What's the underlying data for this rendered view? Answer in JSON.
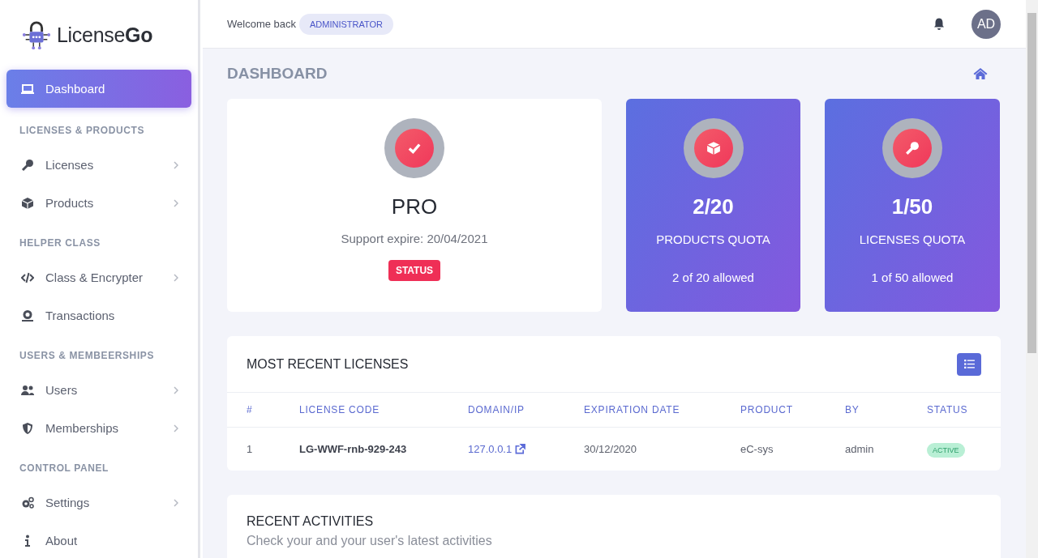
{
  "brand": {
    "name": "License**Go**"
  },
  "sidebar": {
    "items": [
      {
        "kind": "item",
        "label": "Dashboard",
        "selected": true,
        "submenu": false
      },
      {
        "kind": "heading",
        "label": "LICENSES & PRODUCTS"
      },
      {
        "kind": "item",
        "label": "Licenses",
        "selected": false,
        "submenu": true
      },
      {
        "kind": "item",
        "label": "Products",
        "selected": false,
        "submenu": true
      },
      {
        "kind": "heading",
        "label": "HELPER CLASS"
      },
      {
        "kind": "item",
        "label": "Class & Encrypter",
        "selected": false,
        "submenu": true
      },
      {
        "kind": "item",
        "label": "Transactions",
        "selected": false,
        "submenu": false
      },
      {
        "kind": "heading",
        "label": "USERS & MEMBEERSHIPS"
      },
      {
        "kind": "item",
        "label": "Users",
        "selected": false,
        "submenu": true
      },
      {
        "kind": "item",
        "label": "Memberships",
        "selected": false,
        "submenu": true
      },
      {
        "kind": "heading",
        "label": "CONTROL PANEL"
      },
      {
        "kind": "item",
        "label": "Settings",
        "selected": false,
        "submenu": true
      },
      {
        "kind": "item",
        "label": "About",
        "selected": false,
        "submenu": false
      }
    ]
  },
  "topbar": {
    "welcome": "Welcome back",
    "role": "ADMINISTRATOR",
    "avatar": "AD"
  },
  "page": {
    "title": "DASHBOARD"
  },
  "cards": [
    {
      "kind": "plan",
      "value": "PRO",
      "subtitle": "Support expire: 20/04/2021",
      "badge": "STATUS"
    },
    {
      "kind": "quota",
      "value": "2/20",
      "label": "PRODUCTS QUOTA",
      "note": "2 of 20 allowed"
    },
    {
      "kind": "quota",
      "value": "1/50",
      "label": "LICENSES QUOTA",
      "note": "1 of 50 allowed"
    }
  ],
  "licenses": {
    "title": "MOST RECENT LICENSES",
    "columns": [
      "#",
      "LICENSE CODE",
      "DOMAIN/IP",
      "EXPIRATION DATE",
      "PRODUCT",
      "BY",
      "STATUS"
    ],
    "rows": [
      {
        "index": "1",
        "code": "LG-WWF-rnb-929-243",
        "domain": "127.0.0.1",
        "expiration": "30/12/2020",
        "product": "eC-sys",
        "by": "admin",
        "status": "ACTIVE"
      }
    ]
  },
  "activities": {
    "title": "RECENT ACTIVITIES",
    "subtitle": "Check your and your user's latest activities"
  }
}
